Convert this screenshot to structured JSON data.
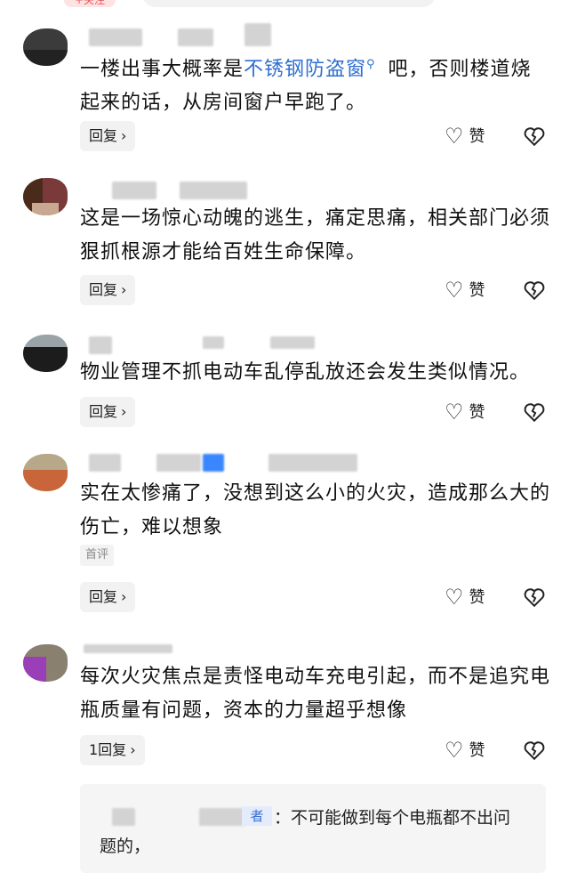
{
  "header": {
    "tag_label": "+关注"
  },
  "comments": [
    {
      "text_before": "一楼出事大概率是",
      "link": "不锈钢防盗窗",
      "text_after": " 吧，否则楼道烧起来的话，从房间窗户早跑了。",
      "reply_label": "回复",
      "like_label": "赞"
    },
    {
      "text": "这是一场惊心动魄的逃生，痛定思痛，相关部门必须狠抓根源才能给百姓生命保障。",
      "reply_label": "回复",
      "like_label": "赞"
    },
    {
      "text": "物业管理不抓电动车乱停乱放还会发生类似情况。",
      "reply_label": "回复",
      "like_label": "赞"
    },
    {
      "text": "实在太惨痛了，没想到这么小的火灾，造成那么大的伤亡，难以想象",
      "badge": "首评",
      "reply_label": "回复",
      "like_label": "赞"
    },
    {
      "text": "每次火灾焦点是责怪电动车充电引起，而不是追究电瓶质量有问题，资本的力量超乎想像",
      "reply_label": "1回复",
      "like_label": "赞"
    }
  ],
  "sub_reply": {
    "author_badge": "者",
    "text": "：不可能做到每个电瓶都不出问题的，"
  },
  "colors": {
    "link": "#2f6fd1",
    "button_bg": "#f2f2f2",
    "sub_bg": "#f5f5f5"
  },
  "icons": {
    "like": "heart-outline-icon",
    "dislike": "broken-heart-icon",
    "chevron": "chevron-right-icon",
    "search": "search-icon"
  }
}
